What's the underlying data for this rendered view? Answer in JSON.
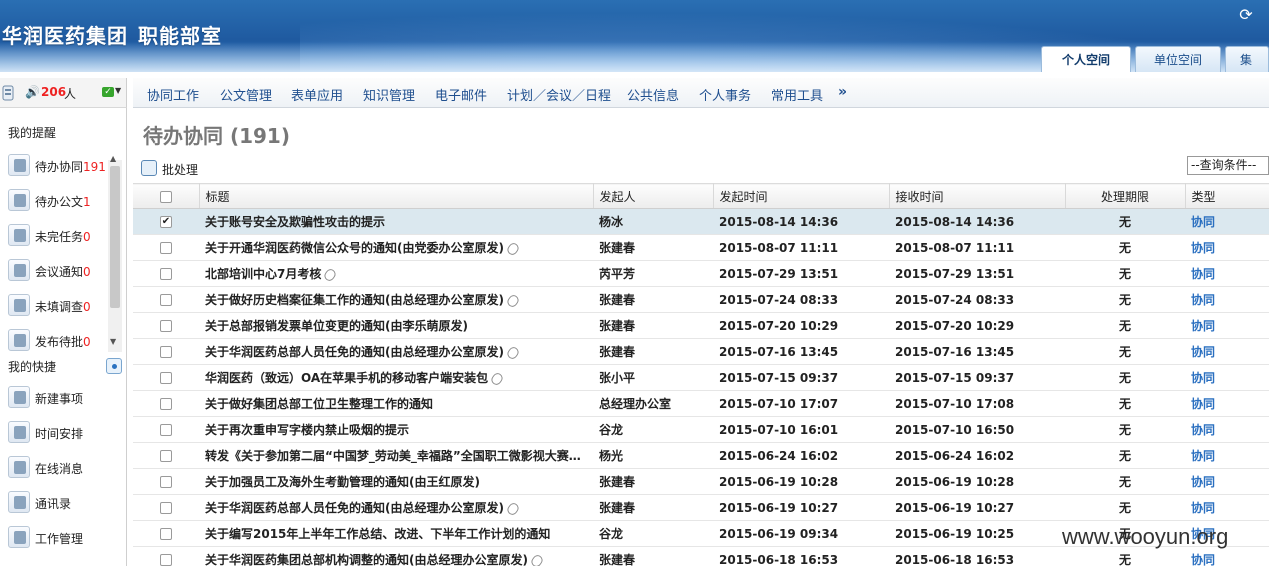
{
  "header": {
    "org": "华润医药集团",
    "dept": "职能部室",
    "tabs": [
      "个人空间",
      "单位空间",
      "集团"
    ]
  },
  "status": {
    "online_count": "206",
    "online_unit": "人"
  },
  "nav": {
    "items": [
      "协同工作",
      "公文管理",
      "表单应用",
      "知识管理",
      "电子邮件",
      "计划／会议／日程",
      "公共信息",
      "个人事务",
      "常用工具"
    ],
    "more": "»"
  },
  "sidebar": {
    "reminders_title": "我的提醒",
    "reminders": [
      {
        "label": "待办协同",
        "count": "191",
        "icon": "collab-icon"
      },
      {
        "label": "待办公文",
        "count": "1",
        "icon": "document-icon"
      },
      {
        "label": "未完任务",
        "count": "0",
        "icon": "task-icon"
      },
      {
        "label": "会议通知",
        "count": "0",
        "icon": "meeting-icon"
      },
      {
        "label": "未填调查",
        "count": "0",
        "icon": "survey-icon"
      },
      {
        "label": "发布待批",
        "count": "0",
        "icon": "chart-icon"
      }
    ],
    "shortcuts_title": "我的快捷",
    "shortcuts": [
      {
        "label": "新建事项",
        "icon": "new-item-icon"
      },
      {
        "label": "时间安排",
        "icon": "calendar-icon"
      },
      {
        "label": "在线消息",
        "icon": "message-icon"
      },
      {
        "label": "通讯录",
        "icon": "contacts-icon"
      },
      {
        "label": "工作管理",
        "icon": "work-icon"
      }
    ]
  },
  "content": {
    "title": "待办协同 (191)",
    "batch_label": "批处理",
    "query_placeholder": "--查询条件--",
    "columns": [
      "标题",
      "发起人",
      "发起时间",
      "接收时间",
      "处理期限",
      "类型"
    ],
    "rows": [
      {
        "title": "关于账号安全及欺骗性攻击的提示",
        "attach": false,
        "sender": "杨冰",
        "sent": "2015-08-14 14:36",
        "received": "2015-08-14 14:36",
        "deadline": "无",
        "type": "协同",
        "checked": true
      },
      {
        "title": "关于开通华润医药微信公众号的通知(由党委办公室原发)",
        "attach": true,
        "sender": "张建春",
        "sent": "2015-08-07 11:11",
        "received": "2015-08-07 11:11",
        "deadline": "无",
        "type": "协同",
        "checked": false
      },
      {
        "title": "北部培训中心7月考核",
        "attach": true,
        "sender": "芮平芳",
        "sent": "2015-07-29 13:51",
        "received": "2015-07-29 13:51",
        "deadline": "无",
        "type": "协同",
        "checked": false
      },
      {
        "title": "关于做好历史档案征集工作的通知(由总经理办公室原发)",
        "attach": true,
        "sender": "张建春",
        "sent": "2015-07-24 08:33",
        "received": "2015-07-24 08:33",
        "deadline": "无",
        "type": "协同",
        "checked": false
      },
      {
        "title": "关于总部报销发票单位变更的通知(由李乐萌原发)",
        "attach": false,
        "sender": "张建春",
        "sent": "2015-07-20 10:29",
        "received": "2015-07-20 10:29",
        "deadline": "无",
        "type": "协同",
        "checked": false
      },
      {
        "title": "关于华润医药总部人员任免的通知(由总经理办公室原发)",
        "attach": true,
        "sender": "张建春",
        "sent": "2015-07-16 13:45",
        "received": "2015-07-16 13:45",
        "deadline": "无",
        "type": "协同",
        "checked": false
      },
      {
        "title": "华润医药（致远）OA在苹果手机的移动客户端安装包",
        "attach": true,
        "sender": "张小平",
        "sent": "2015-07-15 09:37",
        "received": "2015-07-15 09:37",
        "deadline": "无",
        "type": "协同",
        "checked": false
      },
      {
        "title": "关于做好集团总部工位卫生整理工作的通知",
        "attach": false,
        "sender": "总经理办公室",
        "sent": "2015-07-10 17:07",
        "received": "2015-07-10 17:08",
        "deadline": "无",
        "type": "协同",
        "checked": false
      },
      {
        "title": "关于再次重申写字楼内禁止吸烟的提示",
        "attach": false,
        "sender": "谷龙",
        "sent": "2015-07-10 16:01",
        "received": "2015-07-10 16:50",
        "deadline": "无",
        "type": "协同",
        "checked": false
      },
      {
        "title": "转发《关于参加第二届“中国梦_劳动美_幸福路”全国职工微影视大赛…",
        "attach": false,
        "sender": "杨光",
        "sent": "2015-06-24 16:02",
        "received": "2015-06-24 16:02",
        "deadline": "无",
        "type": "协同",
        "checked": false
      },
      {
        "title": "关于加强员工及海外生考勤管理的通知(由王红原发)",
        "attach": false,
        "sender": "张建春",
        "sent": "2015-06-19 10:28",
        "received": "2015-06-19 10:28",
        "deadline": "无",
        "type": "协同",
        "checked": false
      },
      {
        "title": "关于华润医药总部人员任免的通知(由总经理办公室原发)",
        "attach": true,
        "sender": "张建春",
        "sent": "2015-06-19 10:27",
        "received": "2015-06-19 10:27",
        "deadline": "无",
        "type": "协同",
        "checked": false
      },
      {
        "title": "关于编写2015年上半年工作总结、改进、下半年工作计划的通知",
        "attach": false,
        "sender": "谷龙",
        "sent": "2015-06-19 09:34",
        "received": "2015-06-19 10:25",
        "deadline": "无",
        "type": "协同",
        "checked": false
      },
      {
        "title": "关于华润医药集团总部机构调整的通知(由总经理办公室原发)",
        "attach": true,
        "sender": "张建春",
        "sent": "2015-06-18 16:53",
        "received": "2015-06-18 16:53",
        "deadline": "无",
        "type": "协同",
        "checked": false
      }
    ]
  },
  "watermark": "www.wooyun.org",
  "colors": {
    "header_blue": "#1f5aa0",
    "link_blue": "#2a6fc0",
    "count_red": "#e22222",
    "selected_row": "#dbe8ef"
  }
}
